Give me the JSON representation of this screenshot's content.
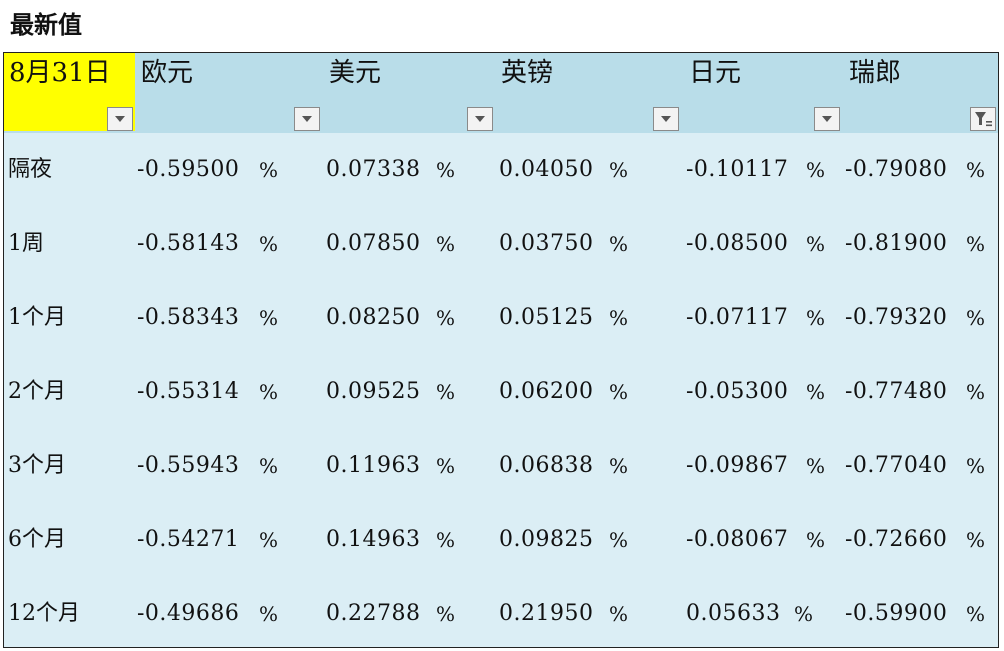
{
  "title": "最新值",
  "corner_label": "8月31日",
  "columns": [
    {
      "label": "欧元"
    },
    {
      "label": "美元"
    },
    {
      "label": "英镑"
    },
    {
      "label": "日元"
    },
    {
      "label": "瑞郎"
    }
  ],
  "percent_sign": "%",
  "rows": [
    {
      "label": "隔夜",
      "values": [
        "-0.59500",
        "0.07338",
        "0.04050",
        "-0.10117",
        "-0.79080"
      ]
    },
    {
      "label": "1周",
      "values": [
        "-0.58143",
        "0.07850",
        "0.03750",
        "-0.08500",
        "-0.81900"
      ]
    },
    {
      "label": "1个月",
      "values": [
        "-0.58343",
        "0.08250",
        "0.05125",
        "-0.07117",
        "-0.79320"
      ]
    },
    {
      "label": "2个月",
      "values": [
        "-0.55314",
        "0.09525",
        "0.06200",
        "-0.05300",
        "-0.77480"
      ]
    },
    {
      "label": "3个月",
      "values": [
        "-0.55943",
        "0.11963",
        "0.06838",
        "-0.09867",
        "-0.77040"
      ]
    },
    {
      "label": "6个月",
      "values": [
        "-0.54271",
        "0.14963",
        "0.09825",
        "-0.08067",
        "-0.72660"
      ]
    },
    {
      "label": "12个月",
      "values": [
        "-0.49686",
        "0.22788",
        "0.21950",
        "0.05633",
        "-0.59900"
      ]
    }
  ],
  "icons": {
    "dropdown": "filter-dropdown-icon",
    "active_filter": "active-filter-icon"
  }
}
